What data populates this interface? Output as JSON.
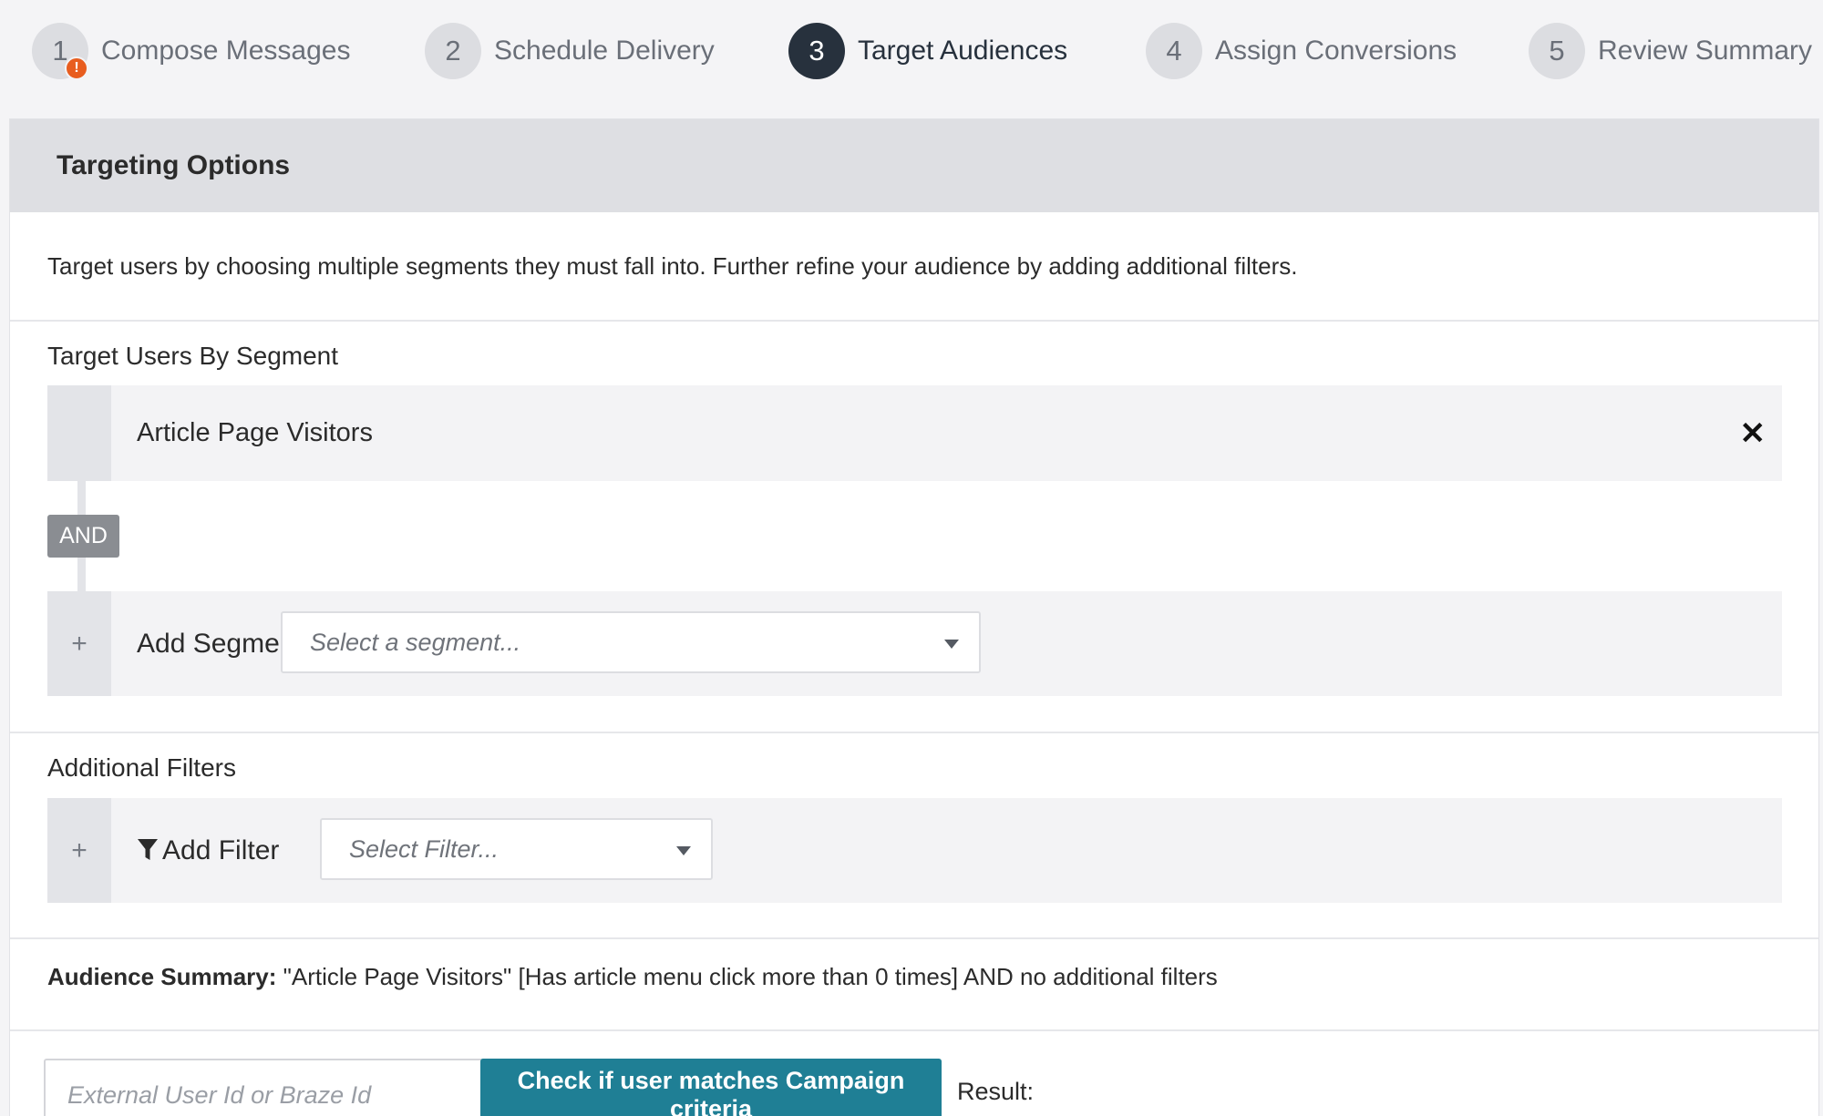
{
  "stepper": {
    "steps": [
      {
        "number": "1",
        "label": "Compose Messages",
        "has_warning": true,
        "warning_glyph": "!"
      },
      {
        "number": "2",
        "label": "Schedule Delivery"
      },
      {
        "number": "3",
        "label": "Target Audiences",
        "active": true
      },
      {
        "number": "4",
        "label": "Assign Conversions"
      },
      {
        "number": "5",
        "label": "Review Summary"
      }
    ]
  },
  "panel": {
    "title": "Targeting Options",
    "description": "Target users by choosing multiple segments they must fall into. Further refine your audience by adding additional filters."
  },
  "segments": {
    "title": "Target Users By Segment",
    "selected": [
      {
        "name": "Article Page Visitors",
        "remove_icon": "close-icon",
        "remove_glyph": "✕"
      }
    ],
    "operator": "AND",
    "add_icon_glyph": "+",
    "add_label": "Add Segment",
    "select_placeholder": "Select a segment..."
  },
  "filters": {
    "title": "Additional Filters",
    "add_icon_glyph": "+",
    "add_label": "Add Filter",
    "select_placeholder": "Select Filter..."
  },
  "summary": {
    "label": "Audience Summary:",
    "text": " \"Article Page Visitors\" [Has article menu click more than 0 times] AND no additional filters"
  },
  "test": {
    "input_placeholder": "External User Id or Braze Id",
    "button_label": "Check if user matches Campaign criteria",
    "result_label": "Result:"
  },
  "colors": {
    "active_step": "#27313d",
    "warning": "#e85d1f",
    "primary_button": "#1f7f95"
  }
}
